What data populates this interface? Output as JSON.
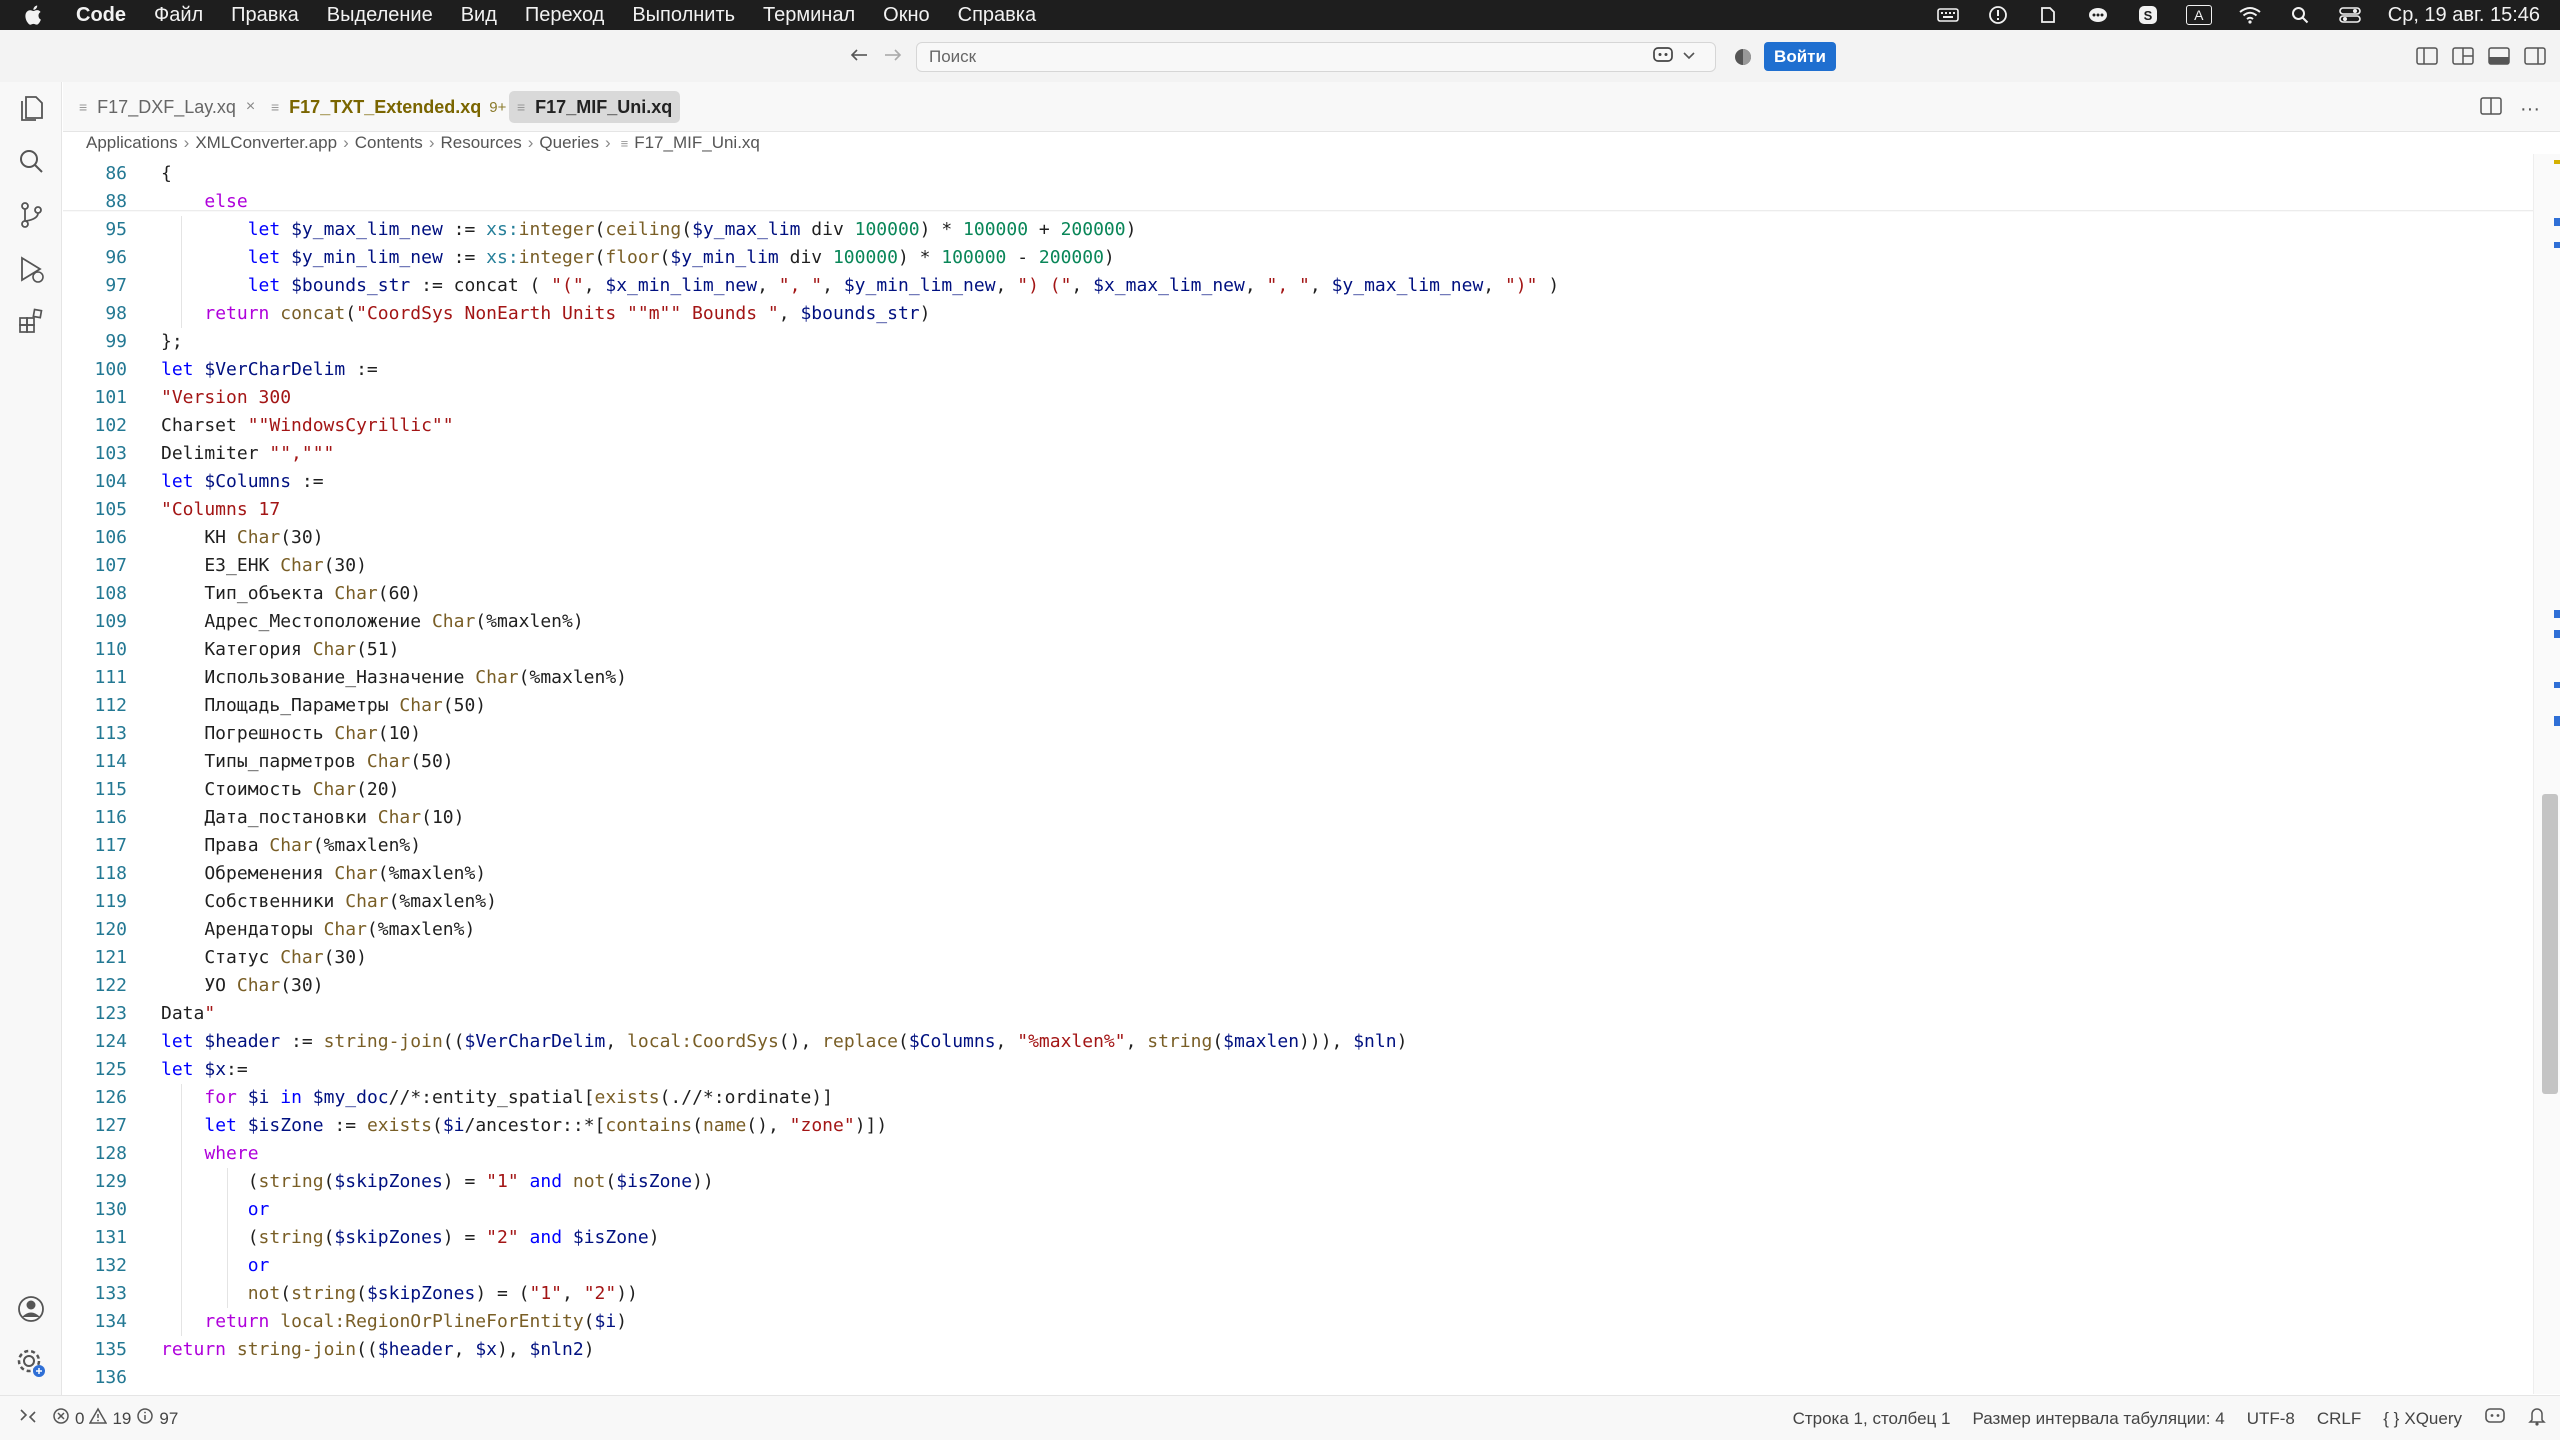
{
  "menubar": {
    "app_name": "Code",
    "items": [
      "Файл",
      "Правка",
      "Выделение",
      "Вид",
      "Переход",
      "Выполнить",
      "Терминал",
      "Окно",
      "Справка"
    ],
    "datetime": "Ср, 19 авг.  15:46",
    "input_source": "A"
  },
  "titlebar": {
    "search_placeholder": "Поиск",
    "signin_label": "Войти"
  },
  "tabs": [
    {
      "label": "F17_DXF_Lay.xq",
      "badge": "",
      "state": "normal"
    },
    {
      "label": "F17_TXT_Extended.xq",
      "badge": "9+",
      "state": "modified"
    },
    {
      "label": "F17_MIF_Uni.xq",
      "badge": "",
      "state": "active"
    }
  ],
  "breadcrumb": [
    "Applications",
    "XMLConverter.app",
    "Contents",
    "Resources",
    "Queries",
    "F17_MIF_Uni.xq"
  ],
  "editor": {
    "line_numbers": [
      "86",
      "88",
      "95",
      "96",
      "97",
      "98",
      "99",
      "100",
      "101",
      "102",
      "103",
      "104",
      "105",
      "106",
      "107",
      "108",
      "109",
      "110",
      "111",
      "112",
      "113",
      "114",
      "115",
      "116",
      "117",
      "118",
      "119",
      "120",
      "121",
      "122",
      "123",
      "124",
      "125",
      "126",
      "127",
      "128",
      "129",
      "130",
      "131",
      "132",
      "133",
      "134",
      "135",
      "136"
    ],
    "lines": [
      "{",
      "    else",
      "        let $y_max_lim_new := xs:integer(ceiling($y_max_lim div 100000) * 100000 + 200000)",
      "        let $y_min_lim_new := xs:integer(floor($y_min_lim div 100000) * 100000 - 200000)",
      "        let $bounds_str := concat ( \"(\", $x_min_lim_new, \", \", $y_min_lim_new, \") (\", $x_max_lim_new, \", \", $y_max_lim_new, \")\" )",
      "    return concat(\"CoordSys NonEarth Units \"\"m\"\" Bounds \", $bounds_str)",
      "};",
      "let $VerCharDelim := ",
      "\"Version 300",
      "Charset \"\"WindowsCyrillic\"\"",
      "Delimiter \"\",\"\"\"",
      "let $Columns :=",
      "\"Columns 17",
      "    КН Char(30)",
      "    ЕЗ_ЕНК Char(30)",
      "    Тип_объекта Char(60)",
      "    Адрес_Местоположение Char(%maxlen%)",
      "    Категория Char(51)",
      "    Использование_Назначение Char(%maxlen%)",
      "    Площадь_Параметры Char(50)",
      "    Погрешность Char(10)",
      "    Типы_парметров Char(50)",
      "    Стоимость Char(20)",
      "    Дата_постановки Char(10)",
      "    Права Char(%maxlen%)",
      "    Обременения Char(%maxlen%)",
      "    Собственники Char(%maxlen%)",
      "    Арендаторы Char(%maxlen%)",
      "    Статус Char(30)",
      "    УО Char(30)",
      "Data\"",
      "let $header := string-join(($VerCharDelim, local:CoordSys(), replace($Columns, \"%maxlen%\", string($maxlen))), $nln)",
      "let $x:=",
      "    for $i in $my_doc//*:entity_spatial[exists(.//*:ordinate)]",
      "    let $isZone := exists($i/ancestor::*[contains(name(), \"zone\")])",
      "    where",
      "        (string($skipZones) = \"1\" and not($isZone))",
      "        or",
      "        (string($skipZones) = \"2\" and $isZone)",
      "        or",
      "        not(string($skipZones) = (\"1\", \"2\"))",
      "    return local:RegionOrPlineForEntity($i)",
      "return string-join(($header, $x), $nln2)",
      ""
    ]
  },
  "statusbar": {
    "errors": "0",
    "warnings": "19",
    "infos": "97",
    "cursor": "Строка 1, столбец 1",
    "indent": "Размер интервала табуляции: 4",
    "encoding": "UTF-8",
    "eol": "CRLF",
    "language": "XQuery"
  },
  "colors": {
    "accent": "#1f6fd0",
    "keyword": "#af00db",
    "function": "#795e26",
    "string": "#a31515",
    "number": "#098658",
    "line_number": "#237893"
  }
}
